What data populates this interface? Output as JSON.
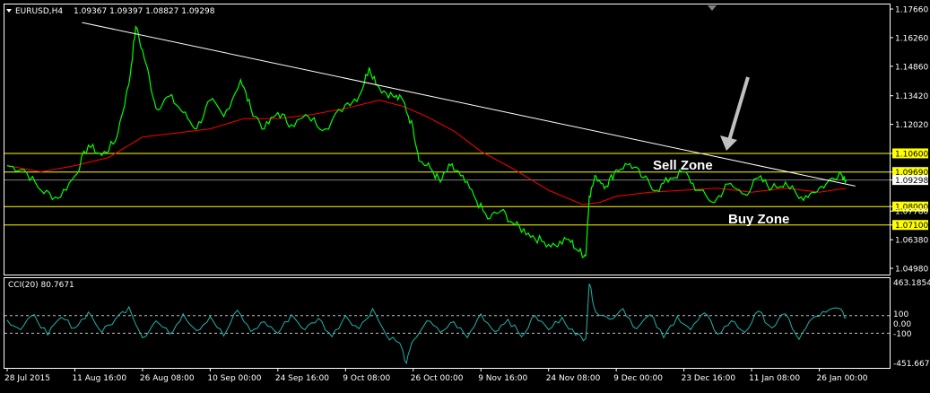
{
  "header": {
    "symbol_tf": "EURUSD,H4",
    "ohlc": "1.09367 1.09397 1.08827 1.09298"
  },
  "indicator": {
    "title": "CCI(20) 80.7671",
    "max_label": "463.1854",
    "min_label": "-451.6679",
    "levels": [
      "100",
      "0.00",
      "-100"
    ]
  },
  "annotations": {
    "sell_zone": "Sell Zone",
    "buy_zone": "Buy Zone"
  },
  "colors": {
    "background": "#000000",
    "price_line": "#00ff00",
    "moving_average": "#ff0000",
    "cci_line": "#20b2aa",
    "horizontal_levels": "#ffff00",
    "trendline": "#ffffff",
    "arrow": "#c0c0c0"
  },
  "chart_data": {
    "type": "line",
    "symbol": "EURUSD",
    "timeframe": "H4",
    "y_ticks": [
      "1.17660",
      "1.16260",
      "1.14860",
      "1.13420",
      "1.12020",
      "1.10600",
      "1.09690",
      "1.09298",
      "1.08000",
      "1.07780",
      "1.07100",
      "1.06380",
      "1.04980"
    ],
    "x_ticks": [
      "28 Jul 2015",
      "11 Aug 16:00",
      "26 Aug 08:00",
      "10 Sep 00:00",
      "24 Sep 16:00",
      "9 Oct 08:00",
      "26 Oct 00:00",
      "9 Nov 16:00",
      "24 Nov 08:00",
      "9 Dec 00:00",
      "23 Dec 16:00",
      "11 Jan 08:00",
      "26 Jan 00:00"
    ],
    "ylim": [
      1.0485,
      1.1775
    ],
    "horizontal_levels": [
      1.106,
      1.0969,
      1.08,
      1.071
    ],
    "current_price": 1.09298,
    "trendline": {
      "from": [
        1,
        1.17
      ],
      "to": [
        12.4,
        1.09
      ]
    },
    "series": [
      {
        "name": "price",
        "values": [
          [
            0.0,
            1.1
          ],
          [
            0.25,
            1.098
          ],
          [
            0.5,
            1.088
          ],
          [
            0.75,
            1.084
          ],
          [
            1.0,
            1.095
          ],
          [
            1.2,
            1.11
          ],
          [
            1.4,
            1.105
          ],
          [
            1.6,
            1.112
          ],
          [
            1.8,
            1.14
          ],
          [
            1.9,
            1.168
          ],
          [
            2.05,
            1.15
          ],
          [
            2.2,
            1.128
          ],
          [
            2.4,
            1.134
          ],
          [
            2.6,
            1.126
          ],
          [
            2.8,
            1.118
          ],
          [
            3.0,
            1.132
          ],
          [
            3.2,
            1.124
          ],
          [
            3.45,
            1.142
          ],
          [
            3.6,
            1.128
          ],
          [
            3.8,
            1.118
          ],
          [
            4.0,
            1.126
          ],
          [
            4.2,
            1.12
          ],
          [
            4.45,
            1.124
          ],
          [
            4.7,
            1.118
          ],
          [
            5.0,
            1.13
          ],
          [
            5.2,
            1.134
          ],
          [
            5.35,
            1.148
          ],
          [
            5.5,
            1.138
          ],
          [
            5.7,
            1.134
          ],
          [
            5.85,
            1.132
          ],
          [
            6.0,
            1.118
          ],
          [
            6.1,
            1.102
          ],
          [
            6.25,
            1.099
          ],
          [
            6.4,
            1.092
          ],
          [
            6.55,
            1.1
          ],
          [
            6.7,
            1.095
          ],
          [
            6.9,
            1.085
          ],
          [
            7.1,
            1.074
          ],
          [
            7.3,
            1.078
          ],
          [
            7.5,
            1.071
          ],
          [
            7.7,
            1.067
          ],
          [
            7.9,
            1.063
          ],
          [
            8.1,
            1.061
          ],
          [
            8.3,
            1.064
          ],
          [
            8.45,
            1.058
          ],
          [
            8.55,
            1.056
          ],
          [
            8.6,
            1.085
          ],
          [
            8.7,
            1.095
          ],
          [
            8.85,
            1.09
          ],
          [
            9.0,
            1.098
          ],
          [
            9.2,
            1.101
          ],
          [
            9.4,
            1.094
          ],
          [
            9.6,
            1.088
          ],
          [
            9.8,
            1.094
          ],
          [
            10.0,
            1.097
          ],
          [
            10.2,
            1.088
          ],
          [
            10.45,
            1.082
          ],
          [
            10.65,
            1.091
          ],
          [
            10.9,
            1.086
          ],
          [
            11.1,
            1.094
          ],
          [
            11.3,
            1.089
          ],
          [
            11.5,
            1.092
          ],
          [
            11.7,
            1.084
          ],
          [
            11.9,
            1.087
          ],
          [
            12.1,
            1.091
          ],
          [
            12.3,
            1.097
          ],
          [
            12.4,
            1.093
          ]
        ]
      },
      {
        "name": "moving_average",
        "values": [
          [
            0.0,
            1.1
          ],
          [
            0.5,
            1.097
          ],
          [
            1.0,
            1.1
          ],
          [
            1.5,
            1.104
          ],
          [
            2.0,
            1.114
          ],
          [
            2.5,
            1.116
          ],
          [
            3.0,
            1.118
          ],
          [
            3.5,
            1.123
          ],
          [
            4.0,
            1.123
          ],
          [
            4.5,
            1.125
          ],
          [
            5.0,
            1.128
          ],
          [
            5.5,
            1.132
          ],
          [
            5.85,
            1.129
          ],
          [
            6.2,
            1.124
          ],
          [
            6.6,
            1.117
          ],
          [
            7.0,
            1.107
          ],
          [
            7.5,
            1.098
          ],
          [
            8.0,
            1.088
          ],
          [
            8.5,
            1.081
          ],
          [
            8.75,
            1.082
          ],
          [
            9.0,
            1.085
          ],
          [
            9.5,
            1.087
          ],
          [
            10.0,
            1.088
          ],
          [
            10.5,
            1.089
          ],
          [
            11.0,
            1.087
          ],
          [
            11.5,
            1.089
          ],
          [
            12.0,
            1.087
          ],
          [
            12.4,
            1.089
          ]
        ]
      },
      {
        "name": "CCI(20)",
        "values": [
          [
            0.0,
            50
          ],
          [
            0.2,
            -60
          ],
          [
            0.4,
            110
          ],
          [
            0.6,
            -120
          ],
          [
            0.8,
            80
          ],
          [
            1.0,
            -40
          ],
          [
            1.2,
            140
          ],
          [
            1.4,
            -90
          ],
          [
            1.6,
            60
          ],
          [
            1.8,
            200
          ],
          [
            2.0,
            -150
          ],
          [
            2.2,
            40
          ],
          [
            2.4,
            -110
          ],
          [
            2.6,
            120
          ],
          [
            2.8,
            -70
          ],
          [
            3.0,
            90
          ],
          [
            3.2,
            -130
          ],
          [
            3.4,
            160
          ],
          [
            3.6,
            -80
          ],
          [
            3.8,
            30
          ],
          [
            4.0,
            -100
          ],
          [
            4.2,
            110
          ],
          [
            4.4,
            -60
          ],
          [
            4.6,
            70
          ],
          [
            4.8,
            -140
          ],
          [
            5.0,
            100
          ],
          [
            5.2,
            -50
          ],
          [
            5.4,
            180
          ],
          [
            5.6,
            -120
          ],
          [
            5.8,
            -210
          ],
          [
            5.9,
            -440
          ],
          [
            6.0,
            -180
          ],
          [
            6.2,
            40
          ],
          [
            6.4,
            -90
          ],
          [
            6.6,
            30
          ],
          [
            6.8,
            -150
          ],
          [
            7.0,
            120
          ],
          [
            7.2,
            -80
          ],
          [
            7.4,
            60
          ],
          [
            7.6,
            -140
          ],
          [
            7.8,
            100
          ],
          [
            8.0,
            -60
          ],
          [
            8.2,
            80
          ],
          [
            8.4,
            -120
          ],
          [
            8.55,
            -160
          ],
          [
            8.6,
            460
          ],
          [
            8.7,
            140
          ],
          [
            8.9,
            60
          ],
          [
            9.1,
            180
          ],
          [
            9.3,
            -50
          ],
          [
            9.5,
            110
          ],
          [
            9.7,
            -150
          ],
          [
            9.9,
            90
          ],
          [
            10.1,
            -60
          ],
          [
            10.3,
            130
          ],
          [
            10.5,
            -110
          ],
          [
            10.7,
            40
          ],
          [
            10.9,
            -90
          ],
          [
            11.1,
            150
          ],
          [
            11.3,
            -40
          ],
          [
            11.5,
            120
          ],
          [
            11.7,
            -170
          ],
          [
            11.9,
            70
          ],
          [
            12.1,
            140
          ],
          [
            12.3,
            180
          ],
          [
            12.4,
            80
          ]
        ]
      }
    ]
  }
}
